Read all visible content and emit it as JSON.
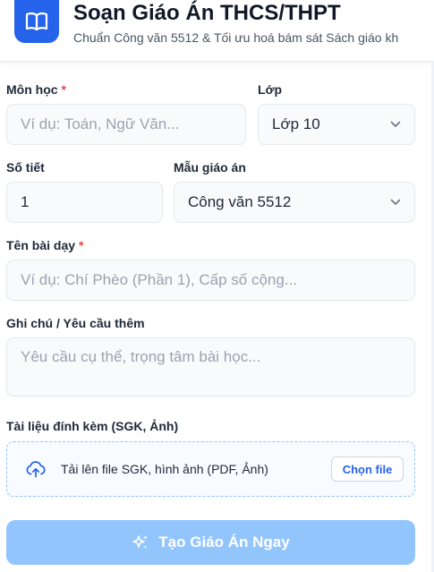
{
  "header": {
    "title": "Soạn Giáo Án THCS/THPT",
    "subtitle": "Chuẩn Công văn 5512 & Tối ưu hoá bám sát Sách giáo kh",
    "logo_icon": "book-open-icon",
    "brand_color": "#2563eb"
  },
  "form": {
    "subject": {
      "label": "Môn học",
      "required_mark": "*",
      "placeholder": "Ví dụ: Toán, Ngữ Văn..."
    },
    "grade": {
      "label": "Lớp",
      "value": "Lớp 10"
    },
    "periods": {
      "label": "Số tiết",
      "value": "1"
    },
    "template": {
      "label": "Mẫu giáo án",
      "value": "Công văn 5512"
    },
    "lesson": {
      "label": "Tên bài dạy",
      "required_mark": "*",
      "placeholder": "Ví dụ: Chí Phèo (Phần 1), Cấp số cộng..."
    },
    "notes": {
      "label": "Ghi chú / Yêu cầu thêm",
      "placeholder": "Yêu cầu cụ thể, trọng tâm bài học..."
    },
    "attachment": {
      "label": "Tài liệu đính kèm (SGK, Ảnh)",
      "upload_text": "Tải lên file SGK, hình ảnh (PDF, Ảnh)",
      "choose_button": "Chọn file",
      "icon": "cloud-upload-icon"
    },
    "submit": {
      "label": "Tạo Giáo Án Ngay",
      "icon": "sparkles-icon"
    }
  }
}
